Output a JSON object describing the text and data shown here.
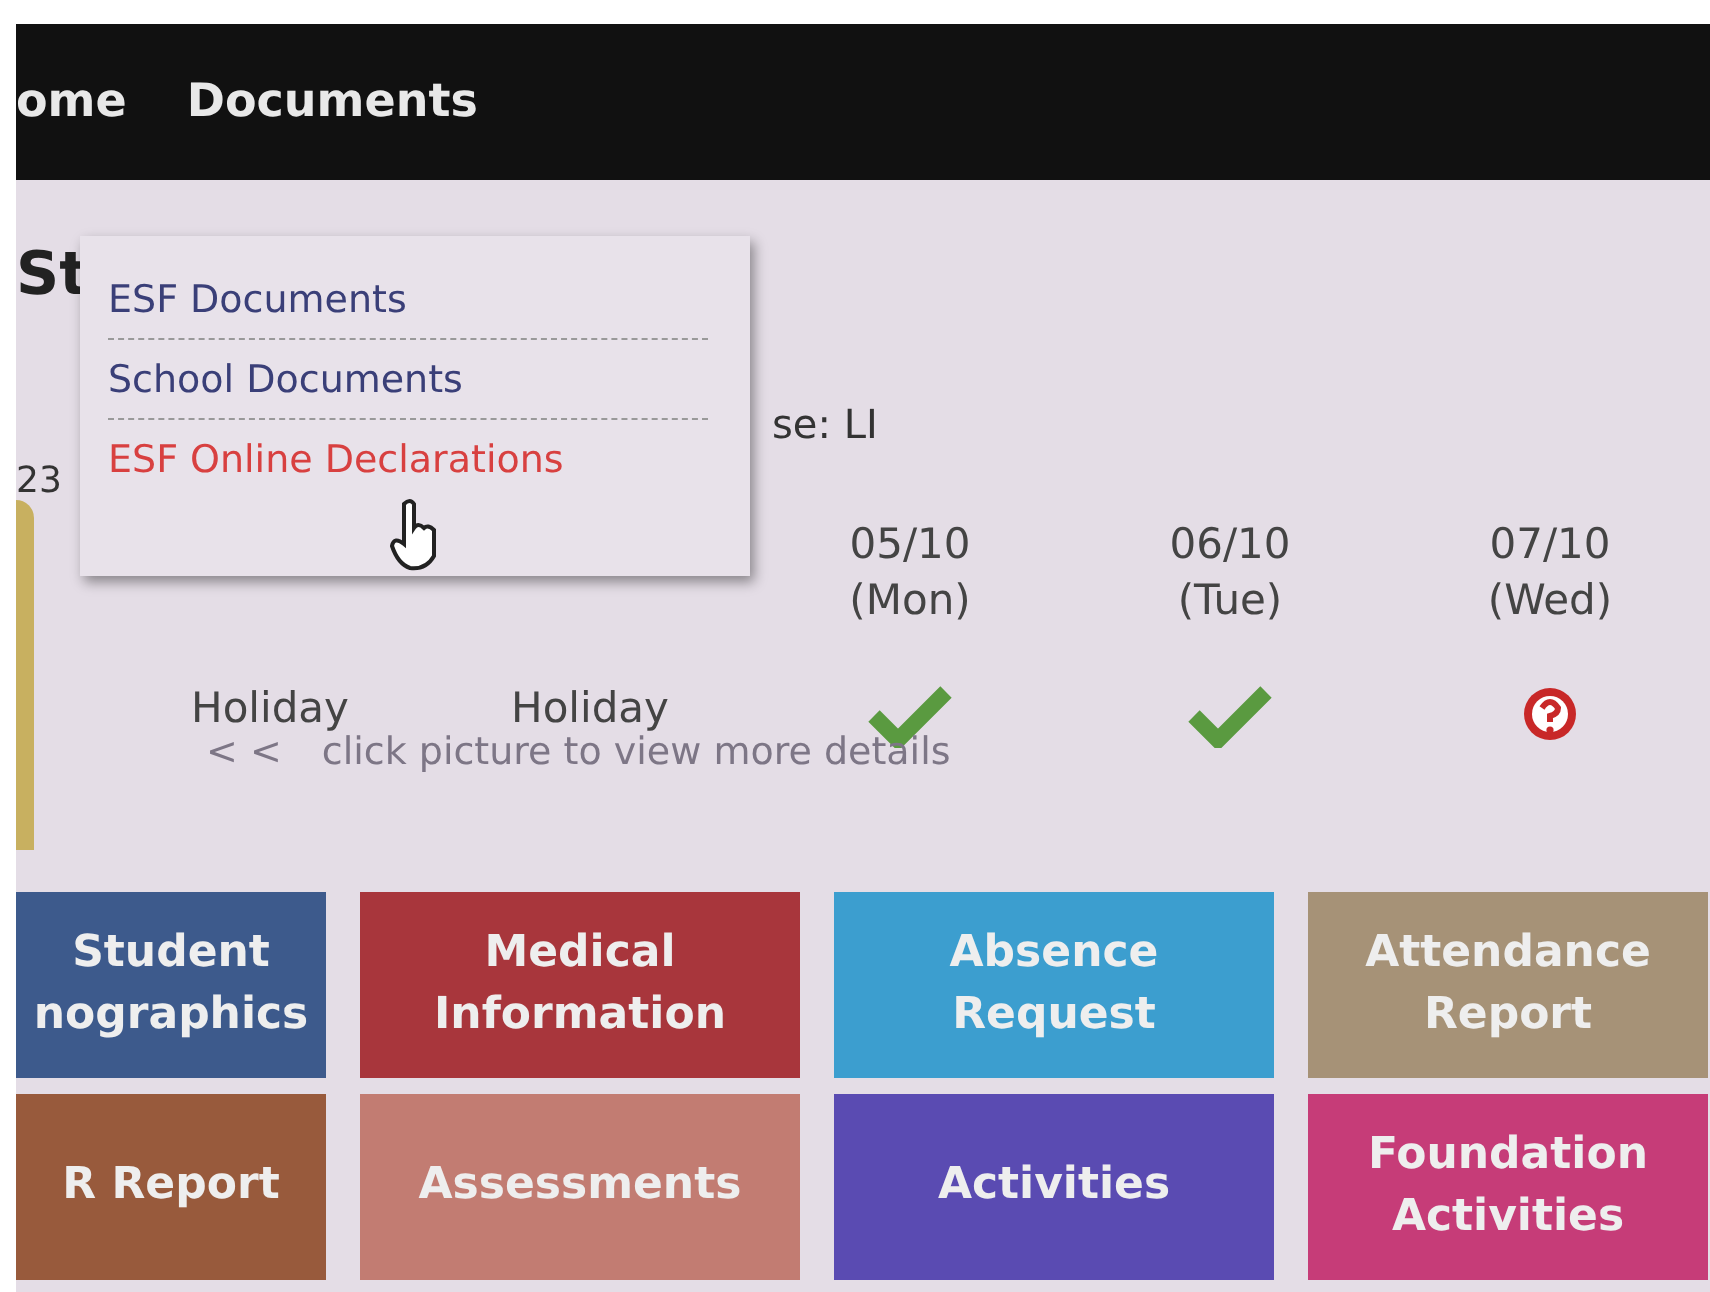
{
  "nav": {
    "items": [
      "ome",
      "Documents"
    ]
  },
  "page": {
    "title": "St",
    "number": "23",
    "class_label": "se: LI"
  },
  "dropdown": {
    "items": [
      {
        "label": "ESF Documents",
        "selected": false
      },
      {
        "label": "School Documents",
        "selected": false
      },
      {
        "label": "ESF Online Declarations",
        "selected": true
      }
    ]
  },
  "attendance": [
    {
      "kind": "text",
      "status": "Holiday"
    },
    {
      "kind": "text",
      "status": "Holiday"
    },
    {
      "date": "05/10",
      "day": "(Mon)",
      "kind": "check"
    },
    {
      "date": "06/10",
      "day": "(Tue)",
      "kind": "check"
    },
    {
      "date": "07/10",
      "day": "(Wed)",
      "kind": "question"
    }
  ],
  "hint": {
    "arrows": "< <",
    "text": "click picture to view more details"
  },
  "tiles": [
    {
      "label": "Student",
      "label2": "nographics",
      "color": "#3d5a8c"
    },
    {
      "label": "Medical",
      "label2": "Information",
      "color": "#a8363c"
    },
    {
      "label": "Absence",
      "label2": "Request",
      "color": "#3c9ecf"
    },
    {
      "label": "Attendance",
      "label2": "Report",
      "color": "#a69277"
    },
    {
      "label": "R Report",
      "color": "#985a3c"
    },
    {
      "label": "Assessments",
      "color": "#c27c72"
    },
    {
      "label": "Activities",
      "color": "#5a4bb2"
    },
    {
      "label": "Foundation",
      "label2": "Activities",
      "color": "#c63c78"
    }
  ]
}
